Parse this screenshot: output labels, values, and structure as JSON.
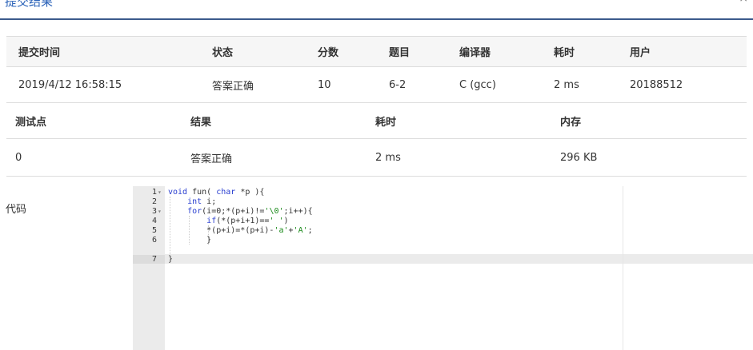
{
  "header": {
    "title": "提交结果",
    "close": "×"
  },
  "submission": {
    "columns": [
      "提交时间",
      "状态",
      "分数",
      "题目",
      "编译器",
      "耗时",
      "用户"
    ],
    "row": {
      "time": "2019/4/12 16:58:15",
      "status": "答案正确",
      "score": "10",
      "problem": "6-2",
      "compiler": "C (gcc)",
      "duration": "2 ms",
      "user": "20188512"
    }
  },
  "testcases": {
    "columns": [
      "测试点",
      "结果",
      "耗时",
      "内存"
    ],
    "row": {
      "case": "0",
      "result": "答案正确",
      "duration": "2 ms",
      "memory": "296 KB"
    }
  },
  "code": {
    "label": "代码",
    "lines": [
      "1",
      "2",
      "3",
      "4",
      "5",
      "6",
      "7"
    ],
    "text": [
      "void fun( char *p ){",
      "    int i;",
      "    for(i=0;*(p+i)!='\\0';i++){",
      "        if(*(p+i+1)==' ')",
      "        *(p+i)=*(p+i)-'a'+'A';",
      "        }",
      "}"
    ]
  },
  "colors": {
    "accent": "#2a62b8",
    "success": "#e0443f",
    "header_border": "#3c5a8c"
  }
}
